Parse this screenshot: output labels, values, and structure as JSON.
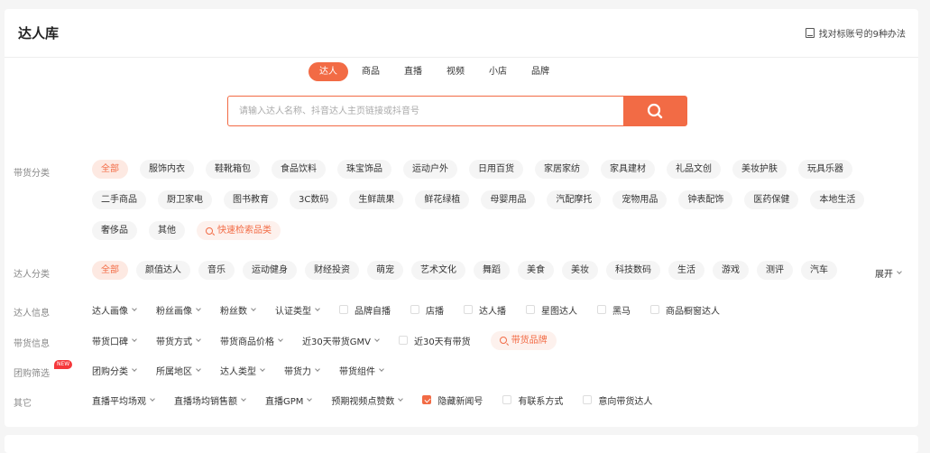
{
  "header": {
    "title": "达人库",
    "help_link": "找对标账号的9种办法"
  },
  "tabs": [
    "达人",
    "商品",
    "直播",
    "视频",
    "小店",
    "品牌"
  ],
  "search": {
    "placeholder": "请输入达人名称、抖音达人主页链接或抖音号"
  },
  "category": {
    "label": "带货分类",
    "row1": [
      "全部",
      "服饰内衣",
      "鞋靴箱包",
      "食品饮料",
      "珠宝饰品",
      "运动户外",
      "日用百货",
      "家居家纺",
      "家具建材",
      "礼品文创",
      "美妆护肤",
      "玩具乐器"
    ],
    "row2": [
      "二手商品",
      "厨卫家电",
      "图书教育",
      "3C数码",
      "生鲜蔬果",
      "鲜花绿植",
      "母婴用品",
      "汽配摩托",
      "宠物用品",
      "钟表配饰",
      "医药保健",
      "本地生活"
    ],
    "row3": [
      "奢侈品",
      "其他"
    ],
    "quick_search": "快速检索品类"
  },
  "influencer_category": {
    "label": "达人分类",
    "items": [
      "全部",
      "颜值达人",
      "音乐",
      "运动健身",
      "财经投资",
      "萌宠",
      "艺术文化",
      "舞蹈",
      "美食",
      "美妆",
      "科技数码",
      "生活",
      "游戏",
      "测评",
      "汽车"
    ],
    "expand": "展开"
  },
  "influencer_info": {
    "label": "达人信息",
    "dropdowns": [
      "达人画像",
      "粉丝画像",
      "粉丝数",
      "认证类型"
    ],
    "checkboxes": [
      "品牌自播",
      "店播",
      "达人播",
      "星图达人",
      "黑马",
      "商品橱窗达人"
    ]
  },
  "sales_info": {
    "label": "带货信息",
    "dropdowns": [
      "带货口碑",
      "带货方式",
      "带货商品价格",
      "近30天带货GMV"
    ],
    "checkbox": "近30天有带货",
    "brand_button": "带货品牌"
  },
  "group_buy": {
    "label": "团购筛选",
    "badge": "NEW",
    "dropdowns": [
      "团购分类",
      "所属地区",
      "达人类型",
      "带货力",
      "带货组件"
    ]
  },
  "other": {
    "label": "其它",
    "dropdowns": [
      "直播平均场观",
      "直播场均销售额",
      "直播GPM",
      "预期视频点赞数"
    ],
    "checkboxes": [
      {
        "label": "隐藏新闻号",
        "checked": true
      },
      {
        "label": "有联系方式",
        "checked": false
      },
      {
        "label": "意向带货达人",
        "checked": false
      }
    ]
  },
  "colors": {
    "accent": "#f26b45",
    "chip_bg": "#f5f5f5",
    "chip_active_bg": "#fde9e2"
  }
}
